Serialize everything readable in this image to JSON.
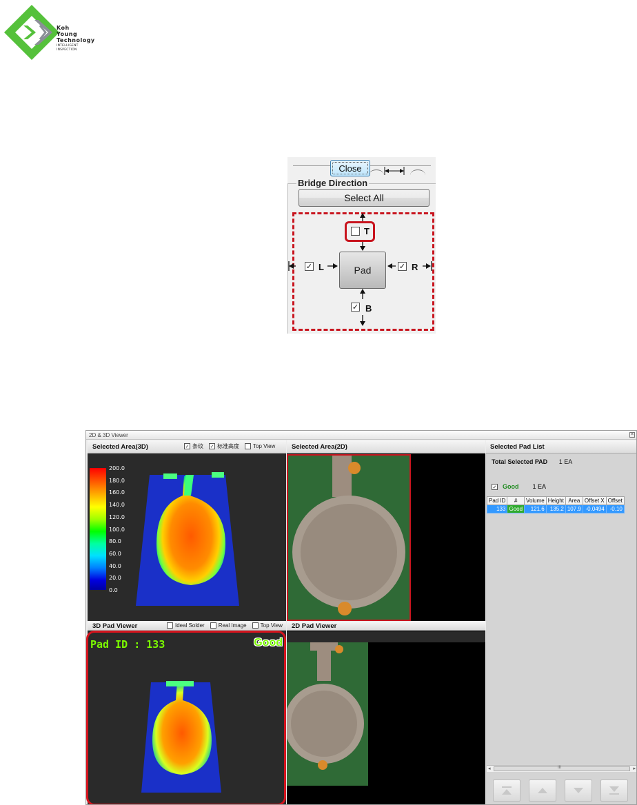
{
  "logo": {
    "line1": "Koh",
    "line2": "Young",
    "line3": "Technology",
    "tagline1": "INTELLIGENT",
    "tagline2": "INSPECTION",
    "colors": {
      "green": "#55c13b",
      "gray": "#8a8f96"
    }
  },
  "bridge_panel": {
    "close_label": "Close",
    "group_title": "Bridge Direction",
    "select_all_label": "Select All",
    "pad_label": "Pad",
    "directions": [
      {
        "label": "T",
        "checked": false,
        "mark": ""
      },
      {
        "label": "L",
        "checked": true,
        "mark": "✓"
      },
      {
        "label": "R",
        "checked": true,
        "mark": "✓"
      },
      {
        "label": "B",
        "checked": true,
        "mark": "✓"
      }
    ],
    "highlight_color": "#c8141e"
  },
  "viewer": {
    "window_title": "2D & 3D Viewer",
    "close_glyph": "×",
    "selected_area_3d": {
      "title": "Selected Area(3D)",
      "options": [
        {
          "label": "条纹",
          "checked": true,
          "mark": "✓"
        },
        {
          "label": "标准高度",
          "checked": true,
          "mark": "✓"
        },
        {
          "label": "Top View",
          "checked": false,
          "mark": ""
        }
      ],
      "colorbar_ticks": [
        "200.0",
        "180.0",
        "160.0",
        "140.0",
        "120.0",
        "100.0",
        "80.0",
        "60.0",
        "40.0",
        "20.0",
        "0.0"
      ]
    },
    "selected_area_2d": {
      "title": "Selected Area(2D)"
    },
    "pad_viewer_3d": {
      "title": "3D Pad Viewer",
      "options": [
        {
          "label": "Ideal Solder",
          "checked": false,
          "mark": ""
        },
        {
          "label": "Real Image",
          "checked": false,
          "mark": ""
        },
        {
          "label": "Top View",
          "checked": false,
          "mark": ""
        }
      ],
      "pad_id_text": "Pad ID : 133",
      "result_text": "Good"
    },
    "pad_viewer_2d": {
      "title": "2D Pad Viewer"
    },
    "pad_list": {
      "title": "Selected Pad List",
      "total_label": "Total Selected PAD",
      "total_value": "1 EA",
      "good_label": "Good",
      "good_checked_mark": "✓",
      "good_value": "1 EA",
      "columns": [
        "Pad ID",
        "#",
        "Volume",
        "Height",
        "Area",
        "Offset X",
        "Offset"
      ],
      "rows": [
        [
          "133",
          "Good",
          "121.6",
          "135.2",
          "107.9",
          "-0.0494",
          "-0.10"
        ]
      ]
    },
    "scroll_mark": "III",
    "scroll_left": "◂",
    "scroll_right": "▸",
    "nav_buttons": [
      "first-icon",
      "up-icon",
      "down-icon",
      "last-icon"
    ]
  }
}
